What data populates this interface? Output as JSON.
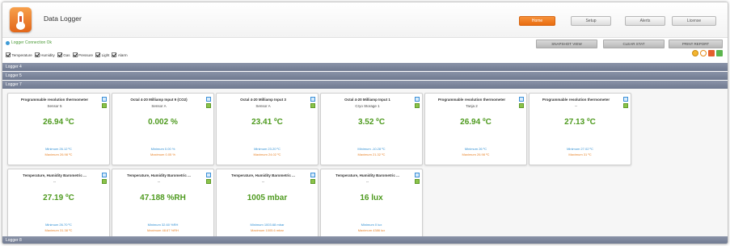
{
  "app": {
    "title": "Data Logger"
  },
  "nav": [
    {
      "label": "Home",
      "active": true
    },
    {
      "label": "Setup",
      "active": false
    },
    {
      "label": "Alerts",
      "active": false
    },
    {
      "label": "License",
      "active": false
    }
  ],
  "connection": {
    "text": "Logger Connection Ok"
  },
  "actions": [
    {
      "label": "SNAPSHOT VIEW"
    },
    {
      "label": "CLEAR STAT"
    },
    {
      "label": "PRINT REPORT"
    }
  ],
  "filters": [
    {
      "label": "Temperature",
      "checked": true
    },
    {
      "label": "Humidity",
      "checked": true
    },
    {
      "label": "Gas",
      "checked": true
    },
    {
      "label": "Pressure",
      "checked": true
    },
    {
      "label": "Light",
      "checked": true
    },
    {
      "label": "Alarm",
      "checked": true
    }
  ],
  "toolbar_icons": [
    "sun-icon",
    "upload-icon",
    "export-icon",
    "grid-icon"
  ],
  "loggers": [
    {
      "label": "Logger 4"
    },
    {
      "label": "Logger 5"
    },
    {
      "label": "Logger 7"
    },
    {
      "label": "Logger 8"
    }
  ],
  "cards": [
    {
      "title": "Programmable resolution thermometer",
      "sub": "Sensor 5",
      "value": "26.94 ºC",
      "min": "Minimum 26.12 ºC",
      "max": "Maximum 26.98 ºC"
    },
    {
      "title": "Octal 4-20 Milliamp Input 9 (CO2)",
      "sub": "Sensor A",
      "value": "0.002 %",
      "min": "Minimum 0.00 %",
      "max": "Maximum 0.05 %"
    },
    {
      "title": "Octal 4-20 Milliamp Input 3",
      "sub": "Sensor A",
      "value": "23.41 ºC",
      "min": "Minimum 23.20 ºC",
      "max": "Maximum 24.02 ºC"
    },
    {
      "title": "Octal 4-20 Milliamp Input 1",
      "sub": "Cryo Storage 1",
      "value": "3.52 ºC",
      "min": "Minimum -10.28 ºC",
      "max": "Maximum 21.32 ºC"
    },
    {
      "title": "Programmable resolution thermometer",
      "sub": "Tanja 2",
      "value": "26.94 ºC",
      "min": "Minimum 26 ºC",
      "max": "Maximum 26.98 ºC"
    },
    {
      "title": "Programmable resolution thermometer",
      "sub": "--",
      "value": "27.13 ºC",
      "min": "Minimum 27.02 ºC",
      "max": "Maximum 31 ºC"
    },
    {
      "title": "Temperature, Humidity Barometric ...",
      "sub": "--",
      "value": "27.19 ºC",
      "min": "Minimum 26.70 ºC",
      "max": "Maximum 31.38 ºC"
    },
    {
      "title": "Temperature, Humidity Barometric ...",
      "sub": "--",
      "value": "47.188 %RH",
      "min": "Minimum 32.60 %RH",
      "max": "Maximum 48.67 %RH"
    },
    {
      "title": "Temperature, Humidity Barometric ...",
      "sub": "--",
      "value": "1005 mbar",
      "min": "Minimum 1003.68 mbar",
      "max": "Maximum 1005.6 mbar"
    },
    {
      "title": "Temperature, Humidity Barometric ...",
      "sub": "--",
      "value": "16 lux",
      "min": "Minimum 0 lux",
      "max": "Maximum 4386 lux"
    }
  ],
  "colors": {
    "accent": "#e96c10",
    "value": "#4e9a1f",
    "min": "#2f8fd3",
    "max": "#e8842a",
    "bar": "#7a8399"
  }
}
